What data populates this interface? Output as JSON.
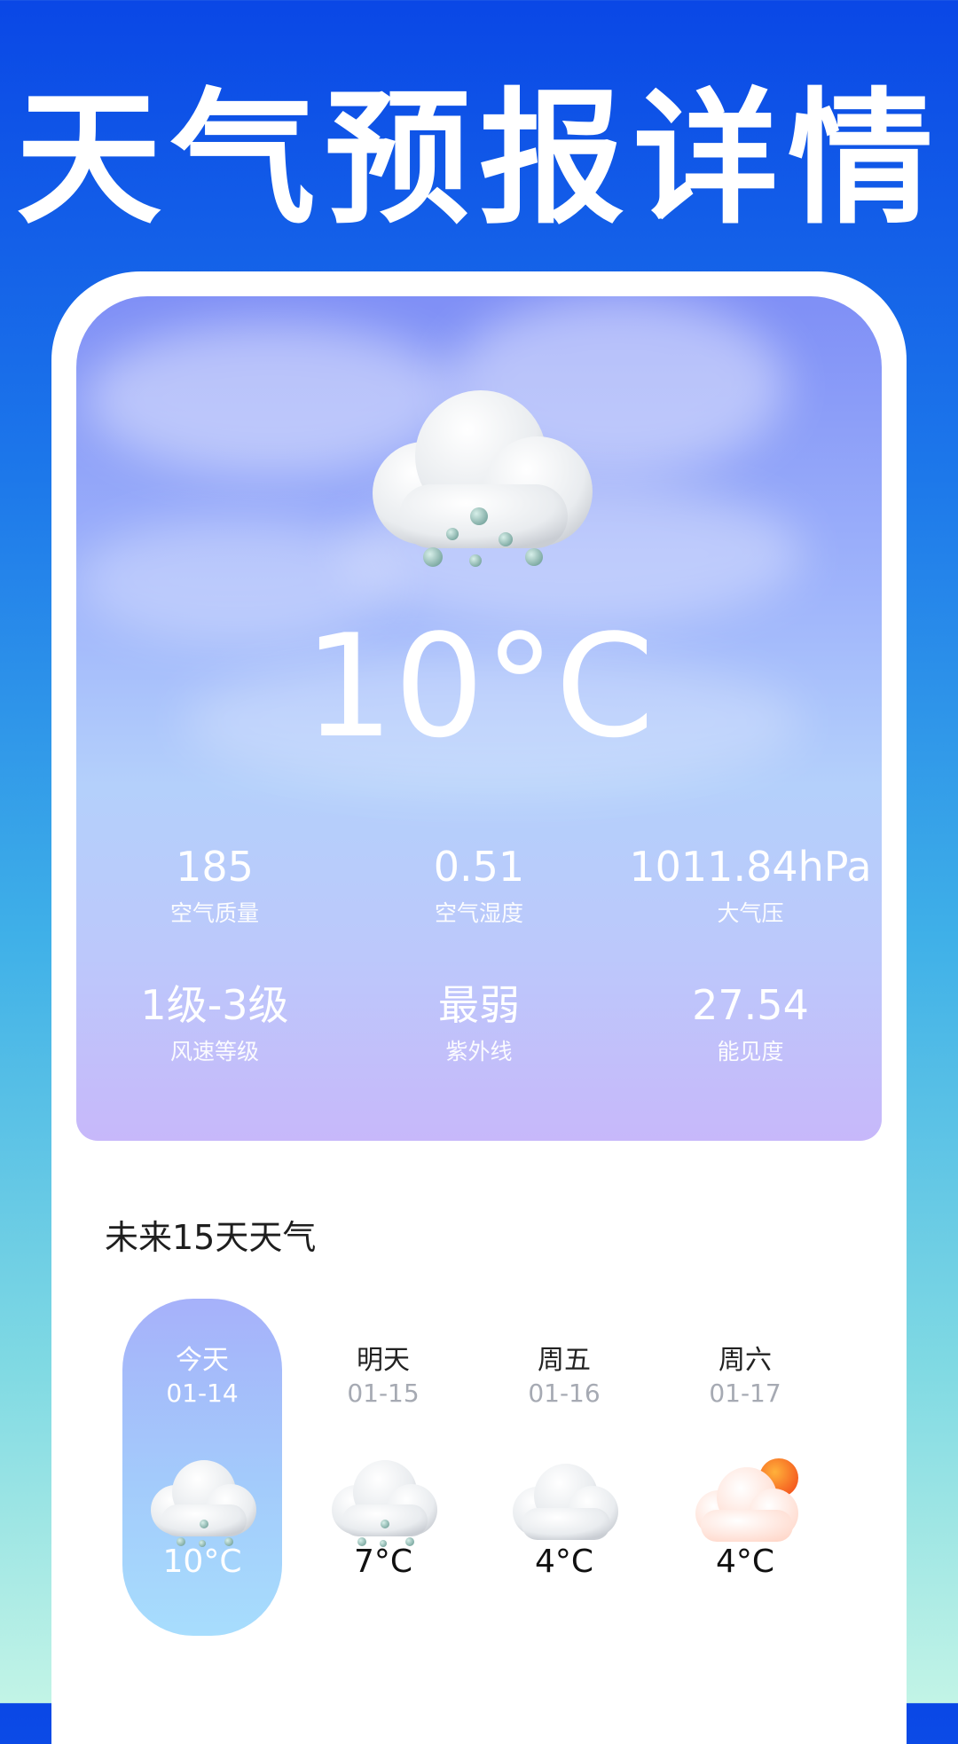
{
  "page_title": "天气预报详情",
  "current": {
    "temperature": "10°C",
    "icon": "cloud-rain-icon"
  },
  "stats": [
    {
      "value": "185",
      "label": "空气质量"
    },
    {
      "value": "0.51",
      "label": "空气湿度"
    },
    {
      "value": "1011.84hPa",
      "label": "大气压"
    },
    {
      "value": "1级-3级",
      "label": "风速等级"
    },
    {
      "value": "最弱",
      "label": "紫外线"
    },
    {
      "value": "27.54",
      "label": "能见度"
    }
  ],
  "forecast": {
    "title": "未来15天天气",
    "days": [
      {
        "name": "今天",
        "date": "01-14",
        "temp": "10°C",
        "icon": "cloud-rain-icon",
        "selected": true
      },
      {
        "name": "明天",
        "date": "01-15",
        "temp": "7°C",
        "icon": "cloud-rain-icon"
      },
      {
        "name": "周五",
        "date": "01-16",
        "temp": "4°C",
        "icon": "cloud-icon"
      },
      {
        "name": "周六",
        "date": "01-17",
        "temp": "4°C",
        "icon": "cloud-sun-icon"
      }
    ]
  },
  "colors": {
    "background_top": "#0a47e6",
    "background_bottom": "#c2f4e6",
    "selected_day": "#a3cbfb"
  }
}
